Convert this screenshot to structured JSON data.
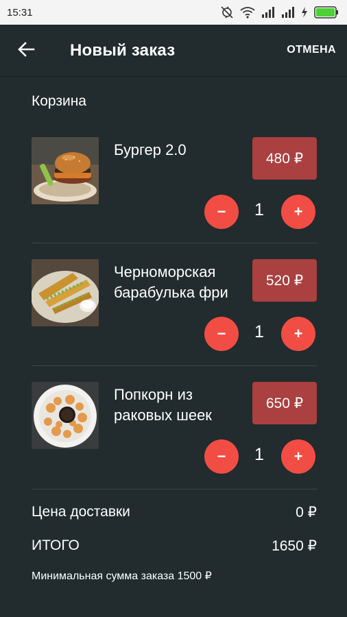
{
  "status_bar": {
    "time": "15:31",
    "icons": [
      "sync-off-icon",
      "wifi-icon",
      "signal-icon",
      "signal-icon",
      "charging-icon",
      "battery-icon"
    ],
    "battery_color": "#4cd137"
  },
  "header": {
    "back_icon": "arrow-left-icon",
    "title": "Новый заказ",
    "cancel_label": "ОТМЕНА"
  },
  "cart": {
    "section_title": "Корзина",
    "items": [
      {
        "name": "Бургер 2.0",
        "price": "480 ₽",
        "quantity": "1",
        "minus_label": "−",
        "plus_label": "+",
        "image": "burger-photo"
      },
      {
        "name": "Черноморская барабулька фри",
        "price": "520 ₽",
        "quantity": "1",
        "minus_label": "−",
        "plus_label": "+",
        "image": "fried-fish-photo"
      },
      {
        "name": "Попкорн из раковых шеек",
        "price": "650 ₽",
        "quantity": "1",
        "minus_label": "−",
        "plus_label": "+",
        "image": "crayfish-popcorn-photo"
      }
    ]
  },
  "summary": {
    "delivery_label": "Цена доставки",
    "delivery_value": "0 ₽",
    "total_label": "ИТОГО",
    "total_value": "1650 ₽",
    "min_order_note": "Минимальная сумма заказа 1500 ₽"
  },
  "colors": {
    "background": "#222b2d",
    "price_tag": "#ab4040",
    "accent_button": "#f24d44",
    "divider": "#3b4547"
  }
}
